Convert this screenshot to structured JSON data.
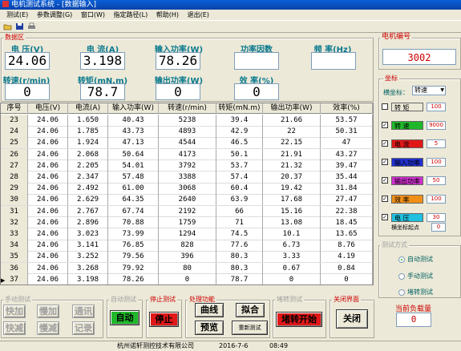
{
  "window": {
    "title": "电机测试系统 - [数据输入]"
  },
  "menu": [
    "测试(E)",
    "参数调整(G)",
    "窗口(W)",
    "指定路径(L)",
    "帮助(H)",
    "退出(E)"
  ],
  "data_area": {
    "title": "数据区",
    "voltage": {
      "label": "电 压(V)",
      "value": "24.06"
    },
    "current": {
      "label": "电 流(A)",
      "value": "3.198"
    },
    "input_power": {
      "label": "输入功率(W)",
      "value": "78.26"
    },
    "power_factor": {
      "label": "功率因数",
      "value": ""
    },
    "frequency": {
      "label": "频 率(Hz)",
      "value": ""
    },
    "speed": {
      "label": "转速(r/min)",
      "value": "0"
    },
    "torque": {
      "label": "转矩(mN.m)",
      "value": "78.7"
    },
    "output_power": {
      "label": "输出功率(W)",
      "value": "0"
    },
    "efficiency": {
      "label": "效 率(%)",
      "value": "0"
    }
  },
  "table": {
    "headers": [
      "序号",
      "电压(V)",
      "电流(A)",
      "输入功率(W)",
      "转速(r/min)",
      "转矩(mN.m)",
      "输出功率(W)",
      "效率(%)"
    ],
    "rows": [
      [
        "23",
        "24.06",
        "1.650",
        "40.43",
        "5238",
        "39.4",
        "21.66",
        "53.57"
      ],
      [
        "24",
        "24.06",
        "1.785",
        "43.73",
        "4893",
        "42.9",
        "22",
        "50.31"
      ],
      [
        "25",
        "24.06",
        "1.924",
        "47.13",
        "4544",
        "46.5",
        "22.15",
        "47"
      ],
      [
        "26",
        "24.06",
        "2.068",
        "50.64",
        "4173",
        "50.1",
        "21.91",
        "43.27"
      ],
      [
        "27",
        "24.06",
        "2.205",
        "54.01",
        "3792",
        "53.7",
        "21.32",
        "39.47"
      ],
      [
        "28",
        "24.06",
        "2.347",
        "57.48",
        "3388",
        "57.4",
        "20.37",
        "35.44"
      ],
      [
        "29",
        "24.06",
        "2.492",
        "61.00",
        "3068",
        "60.4",
        "19.42",
        "31.84"
      ],
      [
        "30",
        "24.06",
        "2.629",
        "64.35",
        "2640",
        "63.9",
        "17.68",
        "27.47"
      ],
      [
        "31",
        "24.06",
        "2.767",
        "67.74",
        "2192",
        "66",
        "15.16",
        "22.38"
      ],
      [
        "32",
        "24.06",
        "2.896",
        "70.88",
        "1759",
        "71",
        "13.08",
        "18.45"
      ],
      [
        "33",
        "24.06",
        "3.023",
        "73.99",
        "1294",
        "74.5",
        "10.1",
        "13.65"
      ],
      [
        "34",
        "24.06",
        "3.141",
        "76.85",
        "828",
        "77.6",
        "6.73",
        "8.76"
      ],
      [
        "35",
        "24.06",
        "3.252",
        "79.56",
        "396",
        "80.3",
        "3.33",
        "4.19"
      ],
      [
        "36",
        "24.06",
        "3.268",
        "79.92",
        "80",
        "80.3",
        "0.67",
        "0.84"
      ],
      [
        "37",
        "24.06",
        "3.198",
        "78.26",
        "0",
        "78.7",
        "0",
        "0"
      ]
    ]
  },
  "motor_number": {
    "label": "电机编号",
    "value": "3002"
  },
  "coord": {
    "title": "坐标",
    "abscissa_label": "横坐标：",
    "abscissa_value": "转速",
    "items": [
      {
        "checked": false,
        "name": "转  矩",
        "value": "100",
        "color": "#ece9d8"
      },
      {
        "checked": true,
        "name": "转  速",
        "value": "9000",
        "color": "#1fb82a"
      },
      {
        "checked": true,
        "name": "电  流",
        "value": "5",
        "color": "#e01818"
      },
      {
        "checked": true,
        "name": "输入功率",
        "value": "100",
        "color": "#2030d0"
      },
      {
        "checked": true,
        "name": "输出功率",
        "value": "50",
        "color": "#d030d0"
      },
      {
        "checked": true,
        "name": "效  率",
        "value": "100",
        "color": "#f09018"
      },
      {
        "checked": true,
        "name": "电  压",
        "value": "30",
        "color": "#20c0e0"
      }
    ],
    "origin_label": "横坐标起点",
    "origin_value": "0"
  },
  "test_mode": {
    "title": "测试方式",
    "options": [
      "自动测试",
      "手动测试",
      "堵转测试"
    ],
    "selected": 0
  },
  "current_load": {
    "label": "当前负载量",
    "value": "0"
  },
  "bottom": {
    "manual_test": {
      "title": "手动测试",
      "buttons": [
        "快加",
        "慢加",
        "通讯",
        "快减",
        "慢减",
        "记录"
      ]
    },
    "auto_test": {
      "title": "自动测试",
      "button": "自动"
    },
    "stop_test": {
      "title": "停止测试",
      "button": "停止"
    },
    "process": {
      "title": "处理功能",
      "buttons": [
        "曲线",
        "拟合",
        "预览",
        "重新测试"
      ]
    },
    "stall": {
      "title": "堵转测试",
      "button": "堵转开始"
    },
    "close": {
      "title": "关闭界面",
      "button": "关闭"
    }
  },
  "status": {
    "company": "杭州诺轩测控技术有限公司",
    "date": "2016-7-6",
    "time": "08:49"
  },
  "colors": {
    "accent_red": "#cc0000",
    "label_teal": "#0a7a8f",
    "stop_red": "#e01818",
    "auto_green": "#1fb82a"
  }
}
